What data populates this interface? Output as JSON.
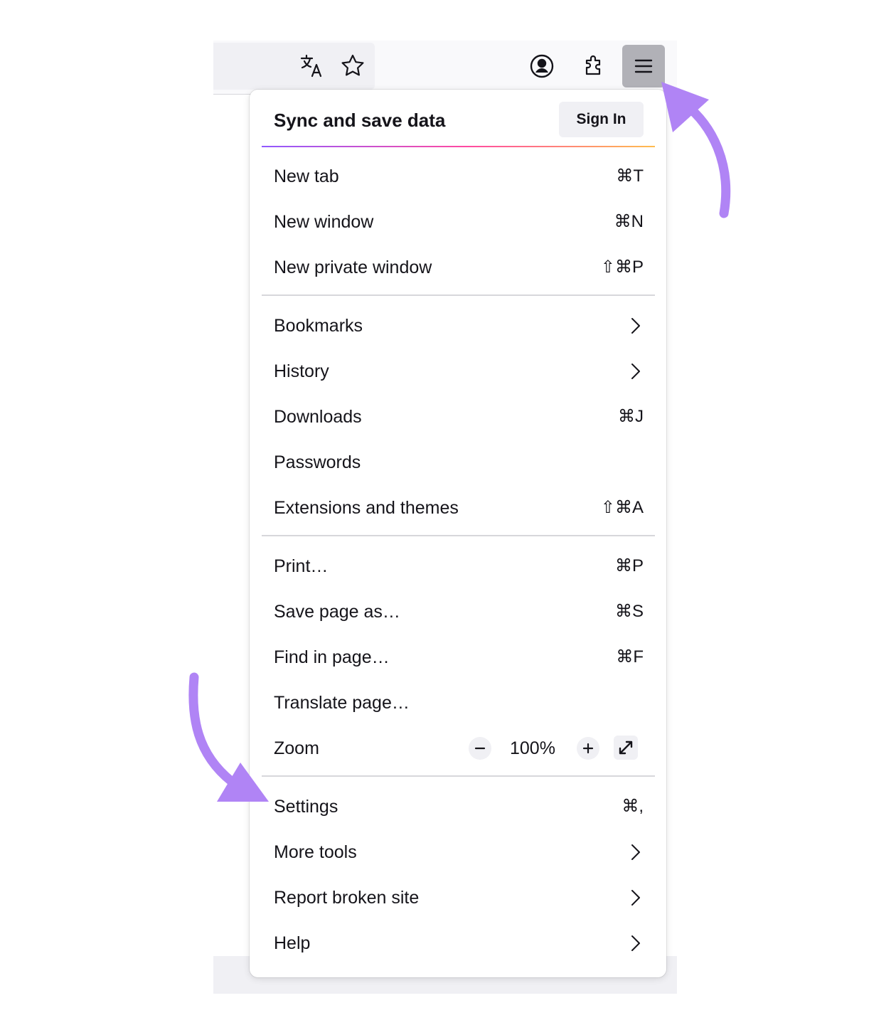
{
  "toolbar": {
    "icons": [
      "translate-icon",
      "star-icon",
      "account-icon",
      "extensions-icon",
      "hamburger-menu-icon"
    ]
  },
  "menu": {
    "header": {
      "title": "Sync and save data",
      "signin_label": "Sign In"
    },
    "items": [
      {
        "label": "New tab",
        "shortcut": "⌘T"
      },
      {
        "label": "New window",
        "shortcut": "⌘N"
      },
      {
        "label": "New private window",
        "shortcut": "⇧⌘P"
      },
      {
        "label": "Bookmarks"
      },
      {
        "label": "History"
      },
      {
        "label": "Downloads",
        "shortcut": "⌘J"
      },
      {
        "label": "Passwords"
      },
      {
        "label": "Extensions and themes",
        "shortcut": "⇧⌘A"
      },
      {
        "label": "Print…",
        "shortcut": "⌘P"
      },
      {
        "label": "Save page as…",
        "shortcut": "⌘S"
      },
      {
        "label": "Find in page…",
        "shortcut": "⌘F"
      },
      {
        "label": "Translate page…"
      },
      {
        "label": "Zoom",
        "value": "100%"
      },
      {
        "label": "Settings",
        "shortcut": "⌘,"
      },
      {
        "label": "More tools"
      },
      {
        "label": "Report broken site"
      },
      {
        "label": "Help"
      }
    ]
  },
  "colors": {
    "annotation_arrow": "#b084f5",
    "separator_gradient": [
      "#9059ff",
      "#ff4aa2",
      "#ffbd4f"
    ],
    "active_button": "#b1b1b7"
  }
}
